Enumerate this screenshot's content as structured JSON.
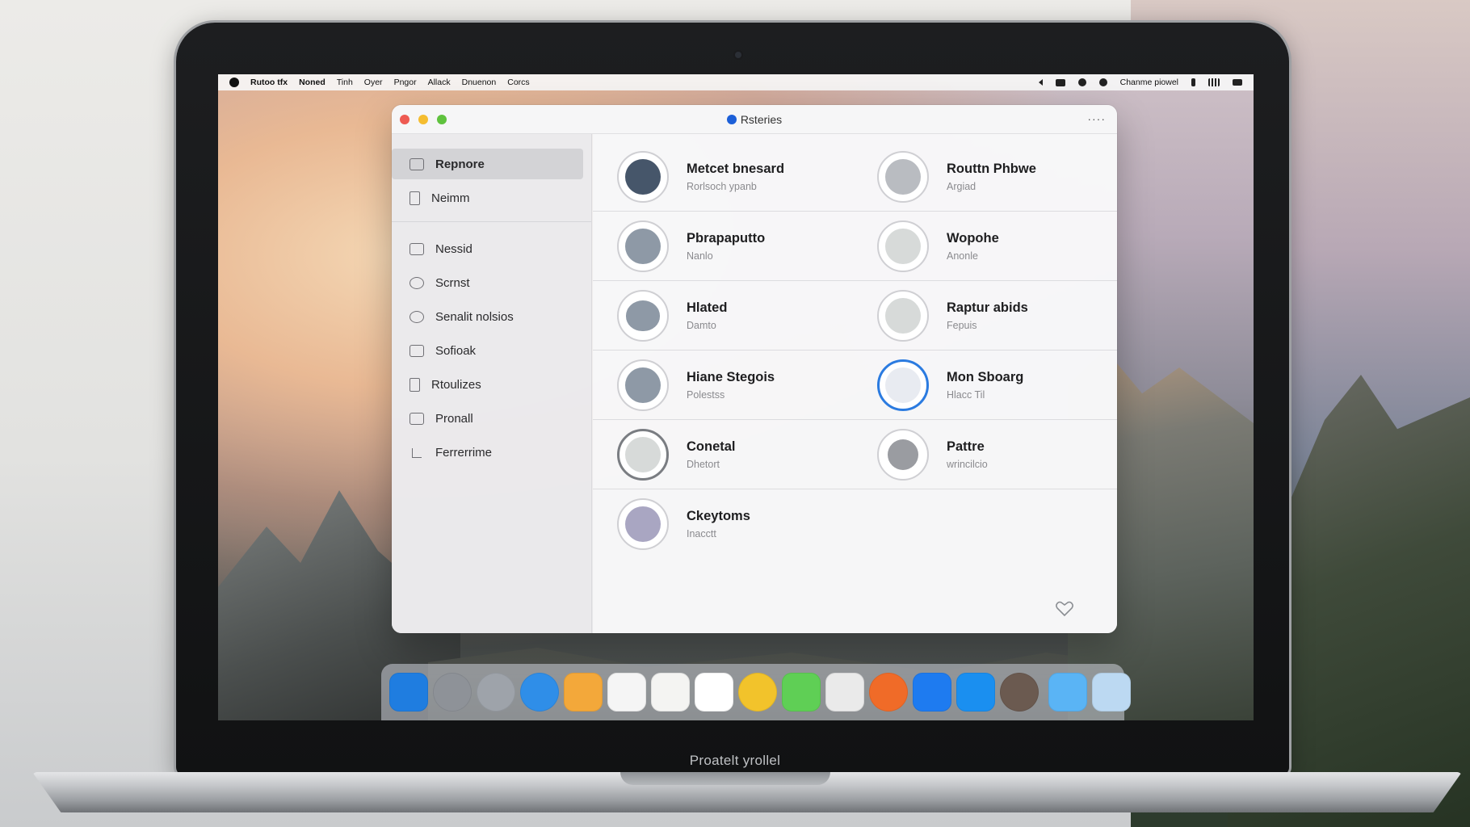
{
  "menubar": {
    "items": [
      "Rutoo tfx",
      "Noned",
      "Tinh",
      "Oyer",
      "Pngor",
      "Allack",
      "Dnuenon",
      "Corcs"
    ],
    "right_text": "Chanme piowel"
  },
  "window": {
    "title": "Rsteries",
    "more_label": "····"
  },
  "sidebar": {
    "top_items": [
      {
        "label": "Repnore",
        "icon": "tray-icon"
      },
      {
        "label": "Neimm",
        "icon": "clipboard-icon"
      }
    ],
    "items": [
      {
        "label": "Nessid",
        "icon": "card-icon"
      },
      {
        "label": "Scrnst",
        "icon": "gear-icon"
      },
      {
        "label": "Senalit nolsios",
        "icon": "cloud-icon"
      },
      {
        "label": "Sofioak",
        "icon": "building-icon"
      },
      {
        "label": "Rtoulizes",
        "icon": "document-icon"
      },
      {
        "label": "Pronall",
        "icon": "window-icon"
      },
      {
        "label": "Ferrerrime",
        "icon": "hand-icon"
      }
    ]
  },
  "grid": {
    "rows": [
      {
        "left": {
          "title": "Metcet bnesard",
          "sub": "Rorlsoch ypanb"
        },
        "right": {
          "title": "Routtn Phbwe",
          "sub": "Argiad"
        }
      },
      {
        "left": {
          "title": "Pbrapaputto",
          "sub": "Nanlo"
        },
        "right": {
          "title": "Wopohe",
          "sub": "Anonle"
        }
      },
      {
        "left": {
          "title": "Hlated",
          "sub": "Damto"
        },
        "right": {
          "title": "Raptur abids",
          "sub": "Fepuis"
        }
      },
      {
        "left": {
          "title": "Hiane Stegois",
          "sub": "Polestss"
        },
        "right": {
          "title": "Mon Sboarg",
          "sub": "Hlacc Til"
        }
      },
      {
        "left": {
          "title": "Conetal",
          "sub": "Dhetort"
        },
        "right": {
          "title": "Pattre",
          "sub": "wrincilcio"
        }
      },
      {
        "left": {
          "title": "Ckeytoms",
          "sub": "Inacctt"
        }
      }
    ]
  },
  "dock": {
    "apps": [
      {
        "name": "xcode-icon",
        "color": "#1f7de0"
      },
      {
        "name": "settings-icon",
        "color": "#8e9298"
      },
      {
        "name": "disk-icon",
        "color": "#9ea3aa"
      },
      {
        "name": "safari-icon",
        "color": "#2f8ee8"
      },
      {
        "name": "notes-icon",
        "color": "#f3a83a"
      },
      {
        "name": "calendar-icon",
        "color": "#f5f5f5"
      },
      {
        "name": "document-icon",
        "color": "#f4f4f2"
      },
      {
        "name": "user-icon",
        "color": "#ffffff"
      },
      {
        "name": "photos-icon",
        "color": "#f2c32b"
      },
      {
        "name": "messages-icon",
        "color": "#5fcf55"
      },
      {
        "name": "podcast-icon",
        "color": "#eaeaea"
      },
      {
        "name": "music-icon",
        "color": "#f06b28"
      },
      {
        "name": "finder-icon",
        "color": "#1e7bf0"
      },
      {
        "name": "mail-icon",
        "color": "#1a8ff0"
      },
      {
        "name": "avatar-icon",
        "color": "#6b5a50"
      },
      {
        "name": "folder-icon",
        "color": "#5ab4f5"
      },
      {
        "name": "trash-icon",
        "color": "#bcd9f2"
      }
    ]
  },
  "laptop": {
    "brand": "Proatelt yrollel"
  }
}
